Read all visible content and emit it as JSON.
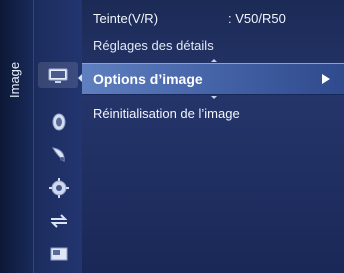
{
  "tab_label": "Image",
  "menu": {
    "rows": [
      {
        "label": "Teinte(V/R)",
        "value": ": V50/R50"
      },
      {
        "label": "Réglages des détails"
      },
      {
        "label": "Options d’image",
        "selected": true
      },
      {
        "label": "Réinitialisation de l’image"
      }
    ]
  },
  "icons": [
    "picture-icon",
    "sound-icon",
    "channel-icon",
    "setup-icon",
    "input-icon",
    "application-icon"
  ],
  "colors": {
    "background": "#1b2a55",
    "highlight": "#4563a7",
    "text": "#f2f5fc"
  }
}
